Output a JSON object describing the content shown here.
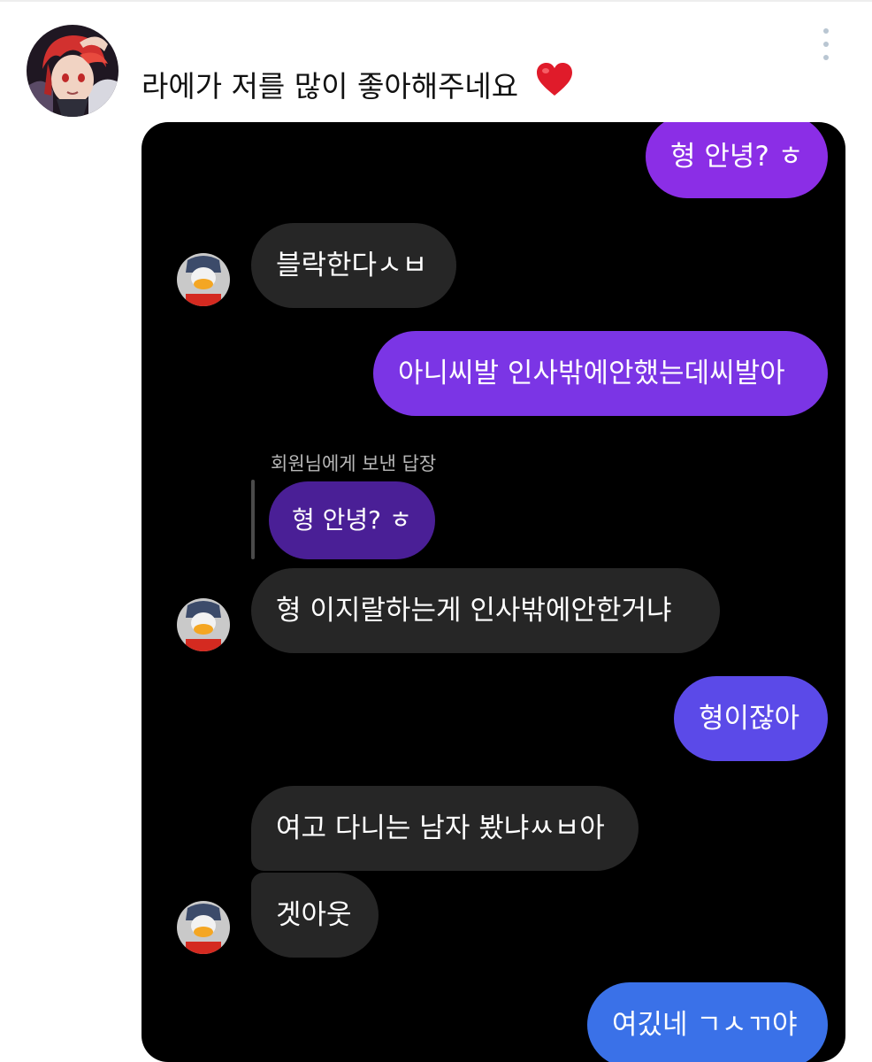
{
  "post": {
    "text": "라에가 저를 많이 좋아해주네요",
    "heart_icon": "heart-icon",
    "more_icon": "more-vertical-icon"
  },
  "chat": {
    "messages": [
      {
        "side": "out",
        "text": "형 안녕? ㅎ",
        "color": "#8b2ee6"
      },
      {
        "side": "in",
        "text": "블락한다ㅅㅂ"
      },
      {
        "side": "out",
        "text": "아니씨발 인사밖에안했는데씨발아",
        "color": "#7b35e5"
      },
      {
        "side": "in",
        "reply_label": "회원님에게 보낸 답장",
        "quoted": "형 안녕? ㅎ",
        "text": "형 이지랄하는게  인사밖에안한거냐"
      },
      {
        "side": "out",
        "text": "형이잖아",
        "color": "#5b4ae8"
      },
      {
        "side": "in",
        "text": "여고 다니는 남자 봤냐ㅆㅂ아"
      },
      {
        "side": "in",
        "text": "겟아웃"
      },
      {
        "side": "out",
        "text": "여깄네 ㄱㅅㄲ야",
        "color": "#3a71e8"
      }
    ]
  }
}
